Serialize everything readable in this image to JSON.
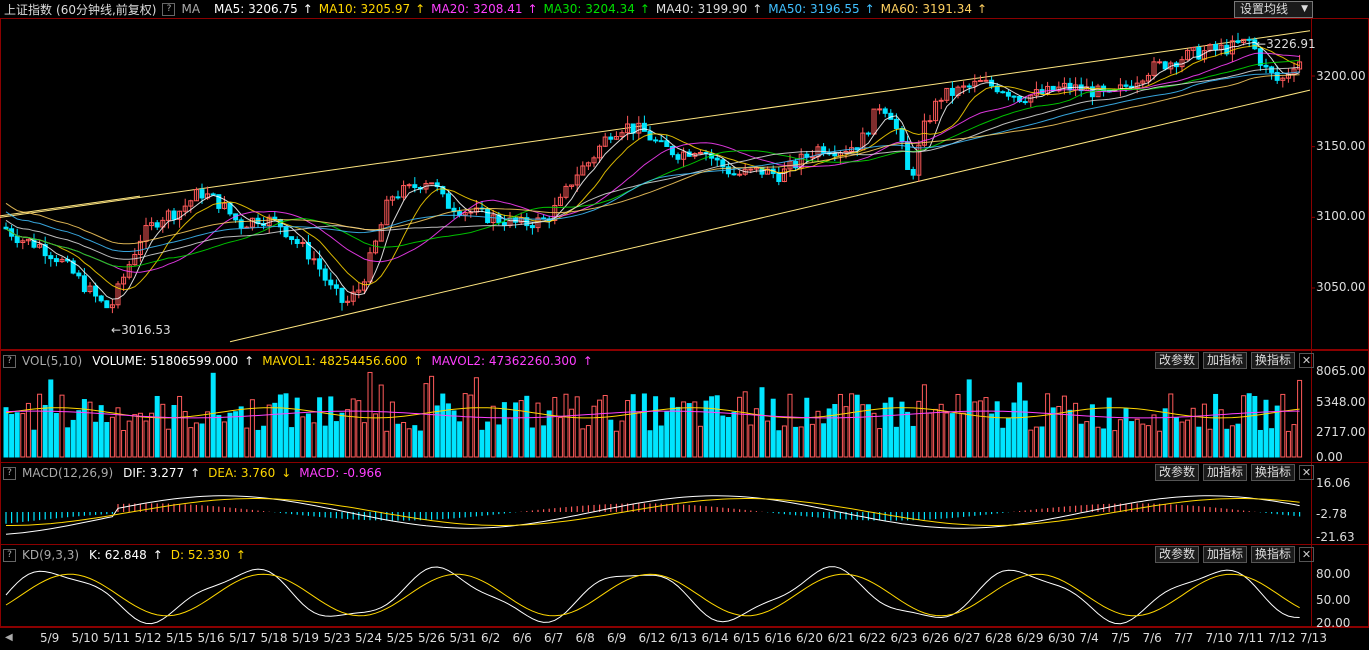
{
  "main_header": {
    "index_name": "上证指数",
    "period": "(60分钟线,前复权)",
    "indicator": "MA",
    "ma": [
      {
        "label": "MA5: 3206.75",
        "color": "#ffffff"
      },
      {
        "label": "MA10: 3205.97",
        "color": "#ffd700"
      },
      {
        "label": "MA20: 3208.41",
        "color": "#ff40ff"
      },
      {
        "label": "MA30: 3204.34",
        "color": "#00e000"
      },
      {
        "label": "MA40: 3199.90",
        "color": "#dddddd"
      },
      {
        "label": "MA50: 3196.55",
        "color": "#40c0ff"
      },
      {
        "label": "MA60: 3191.34",
        "color": "#ffd060"
      }
    ],
    "settings_button": "设置均线",
    "high_marker": "3226.91",
    "low_marker": "3016.53",
    "y_labels": [
      "3200.00",
      "3150.00",
      "3100.00",
      "3050.00"
    ]
  },
  "vol_panel": {
    "title": "VOL(5,10)",
    "volume": "VOLUME: 51806599.000",
    "mavol1": "MAVOL1: 48254456.600",
    "mavol2": "MAVOL2: 47362260.300",
    "y_labels": [
      "8065.00",
      "5348.00",
      "2717.00",
      "0.00"
    ]
  },
  "macd_panel": {
    "title": "MACD(12,26,9)",
    "dif": "DIF: 3.277",
    "dea": "DEA: 3.760",
    "macd": "MACD: -0.966",
    "y_labels": [
      "16.06",
      "-2.78",
      "-21.63"
    ]
  },
  "kd_panel": {
    "title": "KD(9,3,3)",
    "k": "K: 62.848",
    "d": "D: 52.330",
    "y_labels": [
      "80.00",
      "50.00",
      "20.00"
    ]
  },
  "panel_buttons": {
    "change_params": "改参数",
    "add_indicator": "加指标",
    "switch_indicator": "换指标",
    "close": "✕"
  },
  "x_axis_labels": [
    "5/9",
    "5/10",
    "5/11",
    "5/12",
    "5/15",
    "5/16",
    "5/17",
    "5/18",
    "5/19",
    "5/23",
    "5/24",
    "5/25",
    "5/26",
    "5/31",
    "6/2",
    "6/6",
    "6/7",
    "6/8",
    "6/9",
    "6/12",
    "6/13",
    "6/14",
    "6/15",
    "6/16",
    "6/20",
    "6/21",
    "6/22",
    "6/23",
    "6/26",
    "6/27",
    "6/28",
    "6/29",
    "6/30",
    "7/4",
    "7/5",
    "7/6",
    "7/7",
    "7/10",
    "7/11",
    "7/12",
    "7/13"
  ],
  "chart_data": {
    "type": "candlestick",
    "price_axis": {
      "min": 3016.53,
      "max": 3226.91,
      "ticks": [
        3050,
        3100,
        3150,
        3200
      ]
    },
    "channel_lines": {
      "upper": [
        [
          0,
          3100
        ],
        [
          1310,
          3232
        ]
      ],
      "lower": [
        [
          230,
          3012
        ],
        [
          1310,
          3190
        ]
      ],
      "upper_mid": [
        [
          0,
          3101
        ],
        [
          140,
          3115
        ]
      ]
    },
    "price_path": [
      [
        0,
        3095
      ],
      [
        20,
        3085
      ],
      [
        40,
        3080
      ],
      [
        60,
        3070
      ],
      [
        80,
        3055
      ],
      [
        100,
        3040
      ],
      [
        110,
        3035
      ],
      [
        125,
        3060
      ],
      [
        140,
        3085
      ],
      [
        160,
        3100
      ],
      [
        180,
        3105
      ],
      [
        200,
        3118
      ],
      [
        220,
        3110
      ],
      [
        240,
        3095
      ],
      [
        260,
        3100
      ],
      [
        280,
        3095
      ],
      [
        300,
        3080
      ],
      [
        315,
        3070
      ],
      [
        330,
        3050
      ],
      [
        345,
        3038
      ],
      [
        360,
        3050
      ],
      [
        375,
        3080
      ],
      [
        390,
        3115
      ],
      [
        410,
        3120
      ],
      [
        430,
        3128
      ],
      [
        445,
        3110
      ],
      [
        465,
        3105
      ],
      [
        490,
        3100
      ],
      [
        520,
        3095
      ],
      [
        545,
        3098
      ],
      [
        560,
        3110
      ],
      [
        575,
        3130
      ],
      [
        590,
        3140
      ],
      [
        610,
        3160
      ],
      [
        625,
        3165
      ],
      [
        645,
        3160
      ],
      [
        660,
        3150
      ],
      [
        680,
        3145
      ],
      [
        700,
        3150
      ],
      [
        715,
        3140
      ],
      [
        735,
        3130
      ],
      [
        760,
        3133
      ],
      [
        780,
        3130
      ],
      [
        800,
        3140
      ],
      [
        820,
        3150
      ],
      [
        840,
        3148
      ],
      [
        860,
        3152
      ],
      [
        880,
        3180
      ],
      [
        890,
        3175
      ],
      [
        900,
        3155
      ],
      [
        910,
        3125
      ],
      [
        925,
        3165
      ],
      [
        940,
        3185
      ],
      [
        960,
        3190
      ],
      [
        980,
        3195
      ],
      [
        1000,
        3192
      ],
      [
        1020,
        3185
      ],
      [
        1045,
        3188
      ],
      [
        1065,
        3192
      ],
      [
        1090,
        3190
      ],
      [
        1110,
        3185
      ],
      [
        1130,
        3195
      ],
      [
        1150,
        3205
      ],
      [
        1170,
        3210
      ],
      [
        1190,
        3215
      ],
      [
        1210,
        3218
      ],
      [
        1230,
        3220
      ],
      [
        1250,
        3225
      ],
      [
        1265,
        3205
      ],
      [
        1280,
        3195
      ],
      [
        1295,
        3210
      ],
      [
        1305,
        3212
      ]
    ],
    "kd": {
      "k": [
        62.848
      ],
      "d": [
        52.33
      ]
    },
    "macd": {
      "dif": 3.277,
      "dea": 3.76,
      "macd": -0.966
    }
  }
}
